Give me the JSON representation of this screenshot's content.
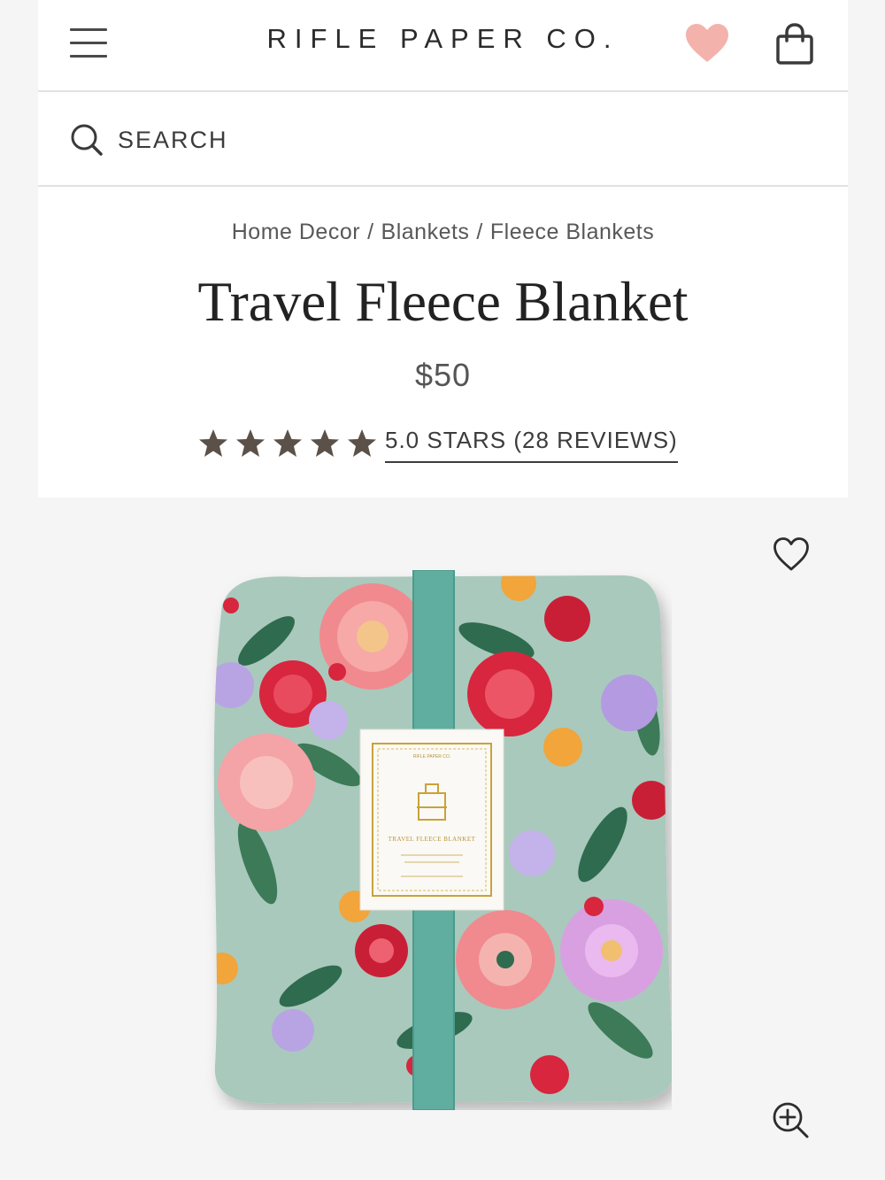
{
  "header": {
    "brand": "RIFLE PAPER CO.",
    "menu_icon": "hamburger-menu-icon",
    "wishlist_icon": "heart-filled-icon",
    "bag_icon": "shopping-bag-icon",
    "wishlist_color": "#f3b3ac"
  },
  "search": {
    "placeholder": "SEARCH",
    "icon": "search-icon"
  },
  "breadcrumb": {
    "items": [
      "Home Decor",
      "Blankets",
      "Fleece Blankets"
    ],
    "separator": "/"
  },
  "product": {
    "title": "Travel Fleece Blanket",
    "price": "$50",
    "rating": {
      "stars": 5,
      "label": "5.0 STARS (28 REVIEWS)"
    },
    "image": {
      "label": "product-image-travel-fleece-blanket",
      "tag_brand": "RIFLE PAPER CO.",
      "tag_title": "TRAVEL FLEECE BLANKET"
    },
    "favorite_icon": "heart-outline-icon",
    "zoom_icon": "zoom-in-icon"
  },
  "colors": {
    "star": "#5b5148",
    "text_dark": "#2b2b2b",
    "divider": "#e3e1e0",
    "ribbon": "#5fae9f",
    "blanket_base": "#a9c9bd"
  }
}
